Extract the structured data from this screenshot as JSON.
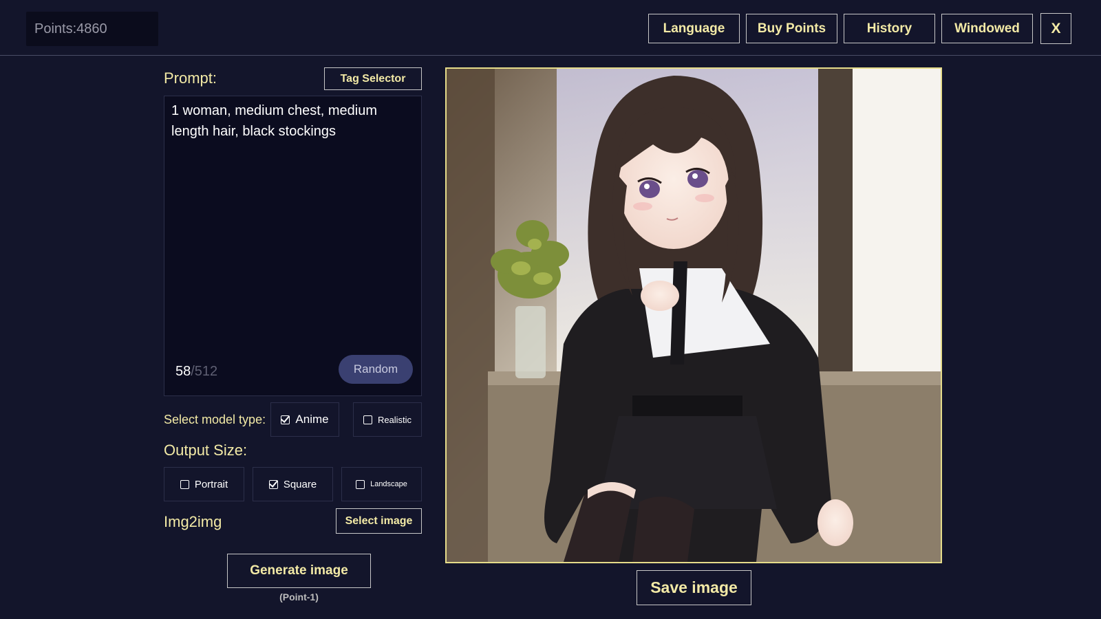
{
  "topbar": {
    "points_label": "Points:4860",
    "buttons": {
      "language": "Language",
      "buy_points": "Buy Points",
      "history": "History",
      "windowed": "Windowed",
      "close": "X"
    }
  },
  "prompt": {
    "label": "Prompt:",
    "tag_selector": "Tag Selector",
    "text": "1 woman, medium chest, medium length hair, black stockings",
    "count_current": "58",
    "count_max": "/512",
    "random": "Random"
  },
  "model_type": {
    "label": "Select model type:",
    "options": [
      {
        "label": "Anime",
        "checked": true
      },
      {
        "label": "Realistic",
        "checked": false
      }
    ]
  },
  "output_size": {
    "label": "Output Size:",
    "options": [
      {
        "label": "Portrait",
        "checked": false
      },
      {
        "label": "Square",
        "checked": true
      },
      {
        "label": "Landscape",
        "checked": false
      }
    ]
  },
  "img2img": {
    "label": "Img2img",
    "select_image": "Select image"
  },
  "generate": {
    "label": "Generate image",
    "cost": "(Point-1)"
  },
  "save": {
    "label": "Save image"
  },
  "colors": {
    "background": "#13152b",
    "accent_text": "#f3eaa6",
    "image_border": "#e6dc8a",
    "random_button": "#3a4071"
  }
}
